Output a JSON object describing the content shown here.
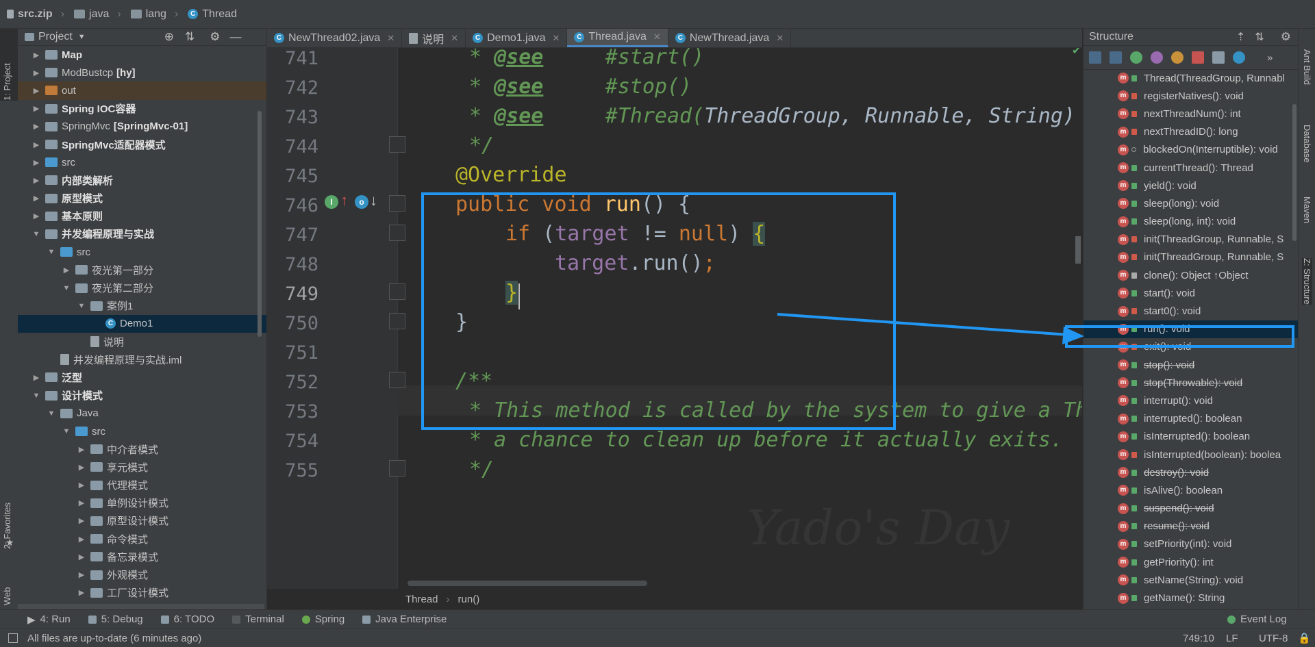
{
  "breadcrumb": [
    "src.zip",
    "java",
    "lang",
    "Thread"
  ],
  "left_strip": {
    "project_tab": "1: Project",
    "favorites_tab": "2: Favorites",
    "web_tab": "Web"
  },
  "project": {
    "title": "Project",
    "items": [
      {
        "label": "Map",
        "bold": true,
        "indent": 0,
        "arrow": "▶",
        "icon": "folder"
      },
      {
        "label": "ModBustcp",
        "suffix": "[hy]",
        "bold": false,
        "indent": 0,
        "arrow": "▶",
        "icon": "folder"
      },
      {
        "label": "out",
        "bold": false,
        "indent": 0,
        "arrow": "▶",
        "icon": "folder-orange"
      },
      {
        "label": "Spring IOC容器",
        "bold": true,
        "indent": 0,
        "arrow": "▶",
        "icon": "folder"
      },
      {
        "label": "SpringMvc",
        "suffix": "[SpringMvc-01]",
        "bold": false,
        "indent": 0,
        "arrow": "▶",
        "icon": "folder"
      },
      {
        "label": "SpringMvc适配器模式",
        "bold": true,
        "indent": 0,
        "arrow": "▶",
        "icon": "folder"
      },
      {
        "label": "src",
        "bold": false,
        "indent": 0,
        "arrow": "▶",
        "icon": "folder-blue"
      },
      {
        "label": "内部类解析",
        "bold": true,
        "indent": 0,
        "arrow": "▶",
        "icon": "folder"
      },
      {
        "label": "原型模式",
        "bold": true,
        "indent": 0,
        "arrow": "▶",
        "icon": "folder"
      },
      {
        "label": "基本原则",
        "bold": true,
        "indent": 0,
        "arrow": "▶",
        "icon": "folder"
      },
      {
        "label": "并发编程原理与实战",
        "bold": true,
        "indent": 0,
        "arrow": "▼",
        "icon": "folder"
      },
      {
        "label": "src",
        "bold": false,
        "indent": 1,
        "arrow": "▼",
        "icon": "folder-blue"
      },
      {
        "label": "夜光第一部分",
        "bold": false,
        "indent": 2,
        "arrow": "▶",
        "icon": "folder"
      },
      {
        "label": "夜光第二部分",
        "bold": false,
        "indent": 2,
        "arrow": "▼",
        "icon": "folder"
      },
      {
        "label": "案例1",
        "bold": false,
        "indent": 3,
        "arrow": "▼",
        "icon": "folder"
      },
      {
        "label": "Demo1",
        "bold": false,
        "indent": 4,
        "arrow": "",
        "icon": "class",
        "selected": true
      },
      {
        "label": "说明",
        "bold": false,
        "indent": 3,
        "arrow": "",
        "icon": "file"
      },
      {
        "label": "并发编程原理与实战.iml",
        "bold": false,
        "indent": 1,
        "arrow": "",
        "icon": "file"
      },
      {
        "label": "泛型",
        "bold": true,
        "indent": 0,
        "arrow": "▶",
        "icon": "folder"
      },
      {
        "label": "设计模式",
        "bold": true,
        "indent": 0,
        "arrow": "▼",
        "icon": "folder"
      },
      {
        "label": "Java",
        "bold": false,
        "indent": 1,
        "arrow": "▼",
        "icon": "folder"
      },
      {
        "label": "src",
        "bold": false,
        "indent": 2,
        "arrow": "▼",
        "icon": "folder-blue"
      },
      {
        "label": "中介者模式",
        "bold": false,
        "indent": 3,
        "arrow": "▶",
        "icon": "folder"
      },
      {
        "label": "享元模式",
        "bold": false,
        "indent": 3,
        "arrow": "▶",
        "icon": "folder"
      },
      {
        "label": "代理模式",
        "bold": false,
        "indent": 3,
        "arrow": "▶",
        "icon": "folder"
      },
      {
        "label": "单例设计模式",
        "bold": false,
        "indent": 3,
        "arrow": "▶",
        "icon": "folder"
      },
      {
        "label": "原型设计模式",
        "bold": false,
        "indent": 3,
        "arrow": "▶",
        "icon": "folder"
      },
      {
        "label": "命令模式",
        "bold": false,
        "indent": 3,
        "arrow": "▶",
        "icon": "folder"
      },
      {
        "label": "备忘录模式",
        "bold": false,
        "indent": 3,
        "arrow": "▶",
        "icon": "folder"
      },
      {
        "label": "外观模式",
        "bold": false,
        "indent": 3,
        "arrow": "▶",
        "icon": "folder"
      },
      {
        "label": "工厂设计模式",
        "bold": false,
        "indent": 3,
        "arrow": "▶",
        "icon": "folder"
      }
    ]
  },
  "tabs": [
    {
      "label": "NewThread02.java",
      "active": false
    },
    {
      "label": "说明",
      "active": false
    },
    {
      "label": "Demo1.java",
      "active": false
    },
    {
      "label": "Thread.java",
      "active": true
    },
    {
      "label": "NewThread.java",
      "active": false
    }
  ],
  "editor": {
    "line_numbers": [
      "741",
      "742",
      "743",
      "744",
      "745",
      "746",
      "747",
      "748",
      "749",
      "750",
      "751",
      "752",
      "753",
      "754",
      "755"
    ],
    "lines": {
      "l741_tag": "@see",
      "l741_ref": "#start()",
      "l742_tag": "@see",
      "l742_ref": "#stop()",
      "l743_tag": "@see",
      "l743_ref_a": "#Thread(",
      "l743_ref_b": "ThreadGroup, Runnable, String)",
      "l744": "*/",
      "l745": "@Override",
      "l746_kw": "public void",
      "l746_fn": "run",
      "l746_rest": "() {",
      "l747_kw": "if",
      "l747_open": " (",
      "l747_fld": "target",
      "l747_op": " != ",
      "l747_null": "null",
      "l747_close": ") ",
      "l747_brace": "{",
      "l748_fld": "target",
      "l748_rest": ".run()",
      "l748_semi": ";",
      "l749": "}",
      "l750": "}",
      "l752": "/**",
      "l753": "* This method is called by the system to give a Th",
      "l754": "* a chance to clean up before it actually exits.",
      "l755": "*/"
    },
    "footer_crumbs": [
      "Thread",
      "run()"
    ],
    "watermark": "Yado's Day"
  },
  "structure": {
    "title": "Structure",
    "items": [
      {
        "label": "Thread(ThreadGroup, Runnabl",
        "lock": "green",
        "strike": false
      },
      {
        "label": "registerNatives(): void",
        "lock": "red",
        "strike": false
      },
      {
        "label": "nextThreadNum(): int",
        "lock": "red",
        "strike": false
      },
      {
        "label": "nextThreadID(): long",
        "lock": "red",
        "strike": false
      },
      {
        "label": "blockedOn(Interruptible): void",
        "lock": "none",
        "strike": false
      },
      {
        "label": "currentThread(): Thread",
        "lock": "green",
        "strike": false
      },
      {
        "label": "yield(): void",
        "lock": "green",
        "strike": false
      },
      {
        "label": "sleep(long): void",
        "lock": "green",
        "strike": false
      },
      {
        "label": "sleep(long, int): void",
        "lock": "green",
        "strike": false
      },
      {
        "label": "init(ThreadGroup, Runnable, S",
        "lock": "red",
        "strike": false
      },
      {
        "label": "init(ThreadGroup, Runnable, S",
        "lock": "red",
        "strike": false
      },
      {
        "label": "clone(): Object ↑Object",
        "lock": "key",
        "strike": false
      },
      {
        "label": "start(): void",
        "lock": "green",
        "strike": false
      },
      {
        "label": "start0(): void",
        "lock": "red",
        "strike": false
      },
      {
        "label": "run(): void",
        "lock": "green",
        "strike": false,
        "selected": true
      },
      {
        "label": "exit(): void",
        "lock": "red",
        "strike": false
      },
      {
        "label": "stop(): void",
        "lock": "green",
        "strike": true
      },
      {
        "label": "stop(Throwable): void",
        "lock": "green",
        "strike": true
      },
      {
        "label": "interrupt(): void",
        "lock": "green",
        "strike": false
      },
      {
        "label": "interrupted(): boolean",
        "lock": "green",
        "strike": false
      },
      {
        "label": "isInterrupted(): boolean",
        "lock": "green",
        "strike": false
      },
      {
        "label": "isInterrupted(boolean): boolea",
        "lock": "red",
        "strike": false
      },
      {
        "label": "destroy(): void",
        "lock": "green",
        "strike": true
      },
      {
        "label": "isAlive(): boolean",
        "lock": "green",
        "strike": false
      },
      {
        "label": "suspend(): void",
        "lock": "green",
        "strike": true
      },
      {
        "label": "resume(): void",
        "lock": "green",
        "strike": true
      },
      {
        "label": "setPriority(int): void",
        "lock": "green",
        "strike": false
      },
      {
        "label": "getPriority(): int",
        "lock": "green",
        "strike": false
      },
      {
        "label": "setName(String): void",
        "lock": "green",
        "strike": false
      },
      {
        "label": "getName(): String",
        "lock": "green",
        "strike": false
      }
    ]
  },
  "right_strip": {
    "ant": "Ant Build",
    "database": "Database",
    "maven": "Maven",
    "structure": "Z: Structure"
  },
  "toolbar": {
    "run": "4: Run",
    "debug": "5: Debug",
    "todo": "6: TODO",
    "terminal": "Terminal",
    "spring": "Spring",
    "java_ee": "Java Enterprise",
    "event_log": "Event Log"
  },
  "status": {
    "message": "All files are up-to-date (6 minutes ago)",
    "position": "749:10",
    "line_sep": "LF",
    "encoding": "UTF-8"
  },
  "colors": {
    "accent": "#2196f3",
    "selection": "#0d293e",
    "keyword": "#cc7832",
    "doc": "#629755",
    "annotation": "#bbb529",
    "field": "#9876aa",
    "function": "#ffc66d"
  }
}
